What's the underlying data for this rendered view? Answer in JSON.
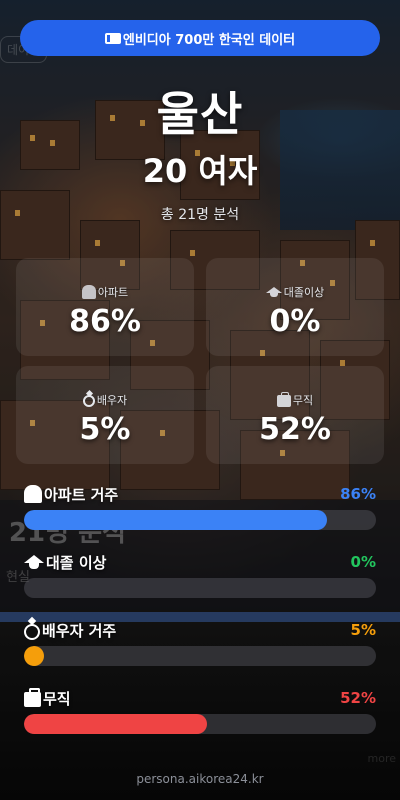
{
  "banner": {
    "text": "엔비디아 700만 한국인 데이터",
    "icon": "book-icon"
  },
  "region": "울산",
  "persona": "20 여자",
  "sample_text": "총 21명 분석",
  "cards": [
    {
      "label": "아파트",
      "value": "86%",
      "icon": "apartment-icon"
    },
    {
      "label": "대졸이상",
      "value": "0%",
      "icon": "graduation-cap-icon"
    },
    {
      "label": "배우자",
      "value": "5%",
      "icon": "ring-icon"
    },
    {
      "label": "무직",
      "value": "52%",
      "icon": "briefcase-icon"
    }
  ],
  "stats": [
    {
      "label": "아파트 거주",
      "value": "86%",
      "fraction": 0.86,
      "color": "#3b82f6"
    },
    {
      "label": "대졸 이상",
      "value": "0%",
      "fraction": 0.0,
      "color": "#22c55e"
    },
    {
      "label": "배우자 거주",
      "value": "5%",
      "fraction": 0.05,
      "color": "#f59e0b"
    },
    {
      "label": "무직",
      "value": "52%",
      "fraction": 0.52,
      "color": "#ef4444"
    }
  ],
  "footer": "persona.aikorea24.kr",
  "colors": {
    "accent": "#2563eb",
    "background": "#0b0f18"
  }
}
